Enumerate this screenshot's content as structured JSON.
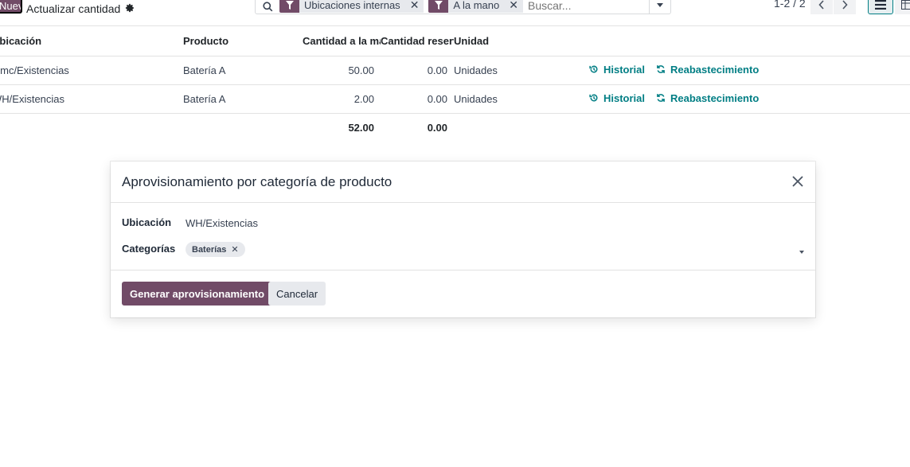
{
  "toolbar": {
    "new_label": "Nuevo",
    "update_quantity_label": "Actualizar cantidad"
  },
  "search": {
    "facets": [
      {
        "label": "Ubicaciones internas"
      },
      {
        "label": "A la mano"
      }
    ],
    "placeholder": "Buscar..."
  },
  "pager": {
    "text": "1-2 / 2"
  },
  "table": {
    "headers": {
      "location": "Ubicación",
      "product": "Producto",
      "qty_on_hand": "Cantidad a la mano",
      "qty_reserved": "Cantidad reservada",
      "unit": "Unidad"
    },
    "rows": [
      {
        "location": "almc/Existencias",
        "product": "Batería A",
        "qty": "50.00",
        "reserved": "0.00",
        "unit": "Unidades",
        "history": "Historial",
        "replenish": "Reabastecimiento"
      },
      {
        "location": "WH/Existencias",
        "product": "Batería A",
        "qty": "2.00",
        "reserved": "0.00",
        "unit": "Unidades",
        "history": "Historial",
        "replenish": "Reabastecimiento"
      }
    ],
    "totals": {
      "qty": "52.00",
      "reserved": "0.00"
    }
  },
  "modal": {
    "title": "Aprovisionamiento por categoría de producto",
    "location_label": "Ubicación",
    "location_value": "WH/Existencias",
    "categories_label": "Categorías",
    "category_tags": [
      {
        "label": "Baterías"
      }
    ],
    "primary_button": "Generar aprovisionamiento",
    "cancel_button": "Cancelar"
  },
  "colors": {
    "primary": "#714b67",
    "link": "#017e84"
  }
}
